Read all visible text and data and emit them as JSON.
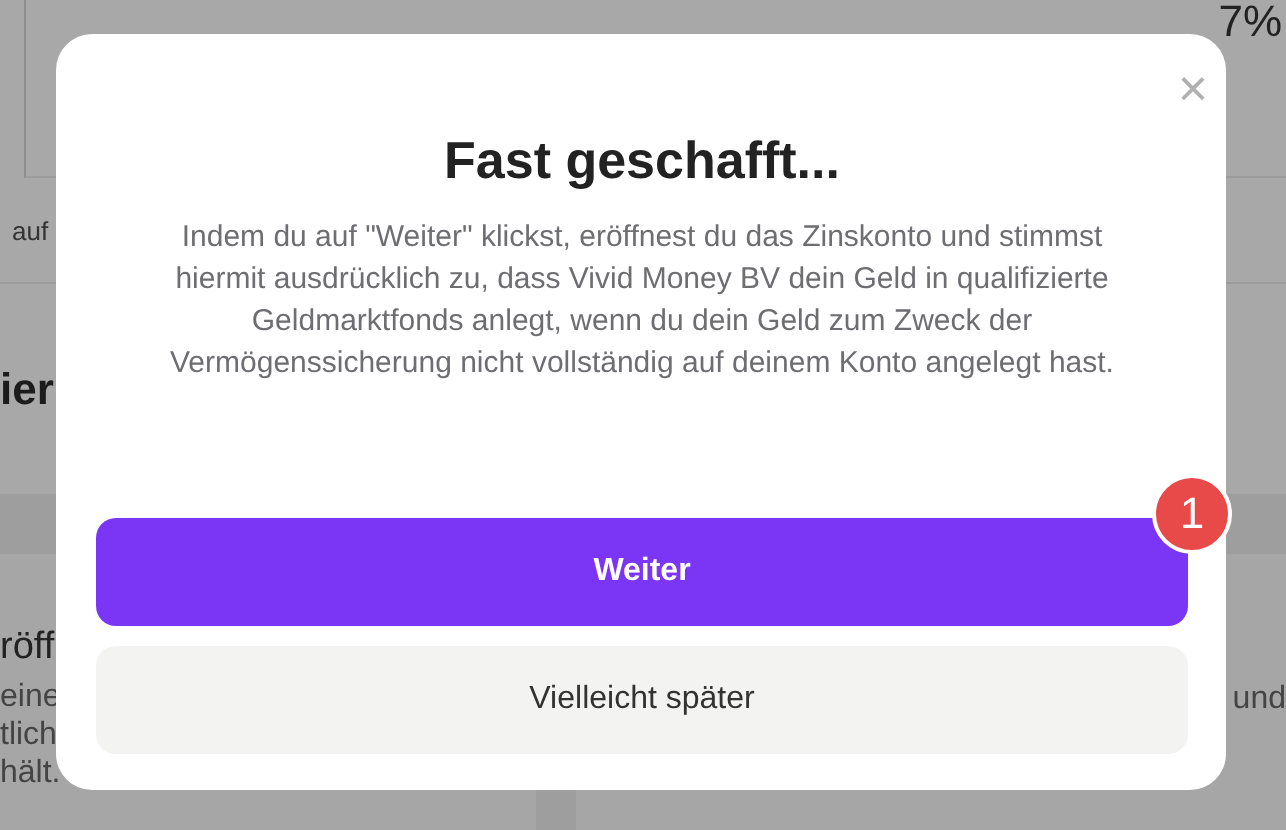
{
  "background": {
    "stat_value": "7%",
    "row_text": "auf",
    "heading": "ier",
    "card_left": {
      "title": "röff",
      "lines": [
        "eine",
        "tlich",
        "hält."
      ]
    },
    "card_right": {
      "text": "und"
    }
  },
  "dialog": {
    "close": "×",
    "title": "Fast geschafft...",
    "message": "Indem du auf \"Weiter\" klickst, eröffnest du das Zinskonto und stimmst hiermit ausdrücklich zu, dass Vivid Money BV dein Geld in qualifizierte Geldmarktfonds anlegt, wenn du dein Geld zum Zweck der Vermögenssicherung nicht vollständig auf deinem Konto angelegt hast.",
    "buttons": [
      {
        "label": "Weiter",
        "kind": "primary",
        "badge": "1"
      },
      {
        "label": "Vielleicht später",
        "kind": "secondary"
      }
    ]
  }
}
